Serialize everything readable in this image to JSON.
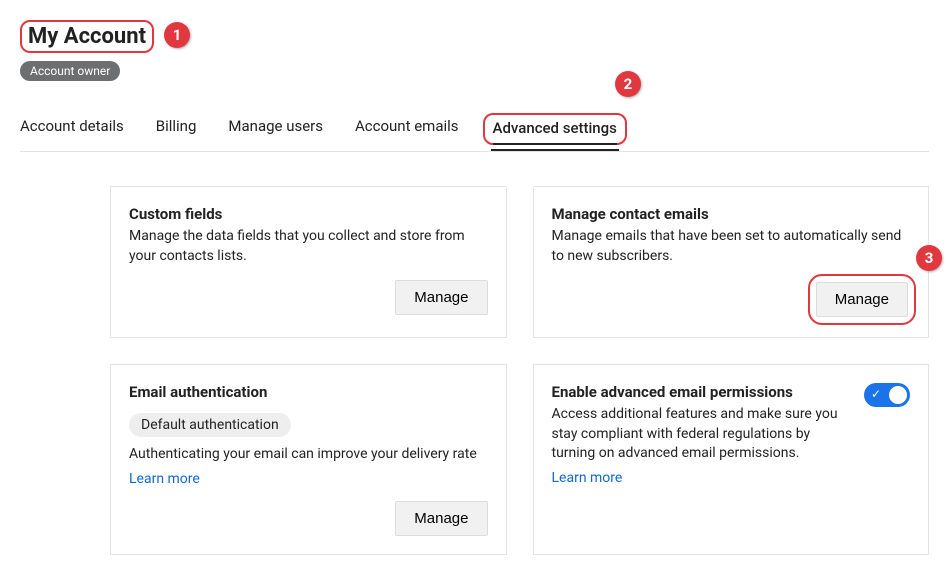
{
  "header": {
    "title": "My Account",
    "badge": "Account owner"
  },
  "tabs": [
    {
      "label": "Account details",
      "active": false
    },
    {
      "label": "Billing",
      "active": false
    },
    {
      "label": "Manage users",
      "active": false
    },
    {
      "label": "Account emails",
      "active": false
    },
    {
      "label": "Advanced settings",
      "active": true
    }
  ],
  "cards": {
    "custom_fields": {
      "title": "Custom fields",
      "desc": "Manage the data fields that you collect and store from your contacts lists.",
      "button": "Manage"
    },
    "contact_emails": {
      "title": "Manage contact emails",
      "desc": "Manage emails that have been set to automatically send to new subscribers.",
      "button": "Manage"
    },
    "email_auth": {
      "title": "Email authentication",
      "chip": "Default authentication",
      "desc": "Authenticating your email can improve your delivery rate",
      "link": "Learn more",
      "button": "Manage"
    },
    "advanced_perm": {
      "title": "Enable advanced email permissions",
      "desc": "Access additional features and make sure you stay compliant with federal regulations by turning on advanced email permissions.",
      "link": "Learn more",
      "toggle_on": true
    }
  },
  "callouts": {
    "c1": "1",
    "c2": "2",
    "c3": "3"
  }
}
